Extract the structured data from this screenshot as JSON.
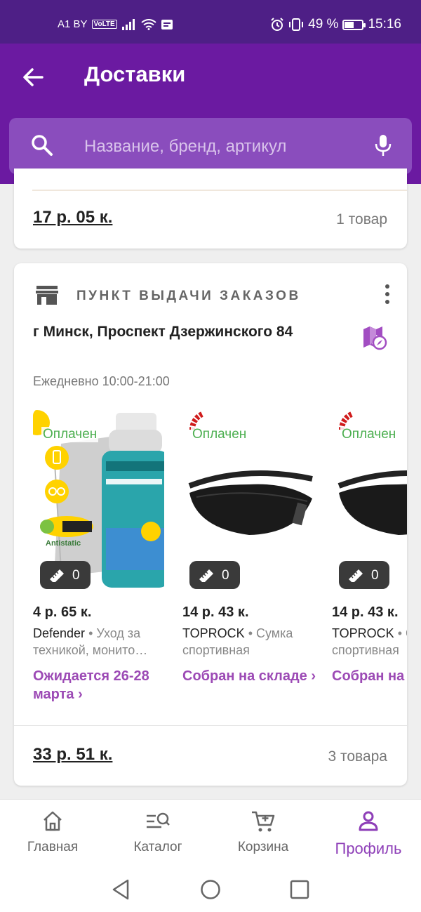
{
  "status_bar": {
    "carrier": "A1 BY",
    "volte": "VoLTE",
    "battery": "49 %",
    "battery_level": 0.49,
    "time": "15:16"
  },
  "app_bar": {
    "title": "Доставки"
  },
  "search": {
    "placeholder": "Название, бренд, артикул"
  },
  "prev_order": {
    "total_price": "17 р. 05 к.",
    "items_count": "1 товар"
  },
  "order": {
    "type_label": "ПУНКТ ВЫДАЧИ ЗАКАЗОВ",
    "address": "г Минск, Проспект Дзержинского 84",
    "hours": "Ежедневно 10:00-21:00",
    "products": [
      {
        "status": "Оплачен",
        "size_count": "0",
        "price": "4 р. 65 к.",
        "brand": "Defender",
        "category": " • Уход за техникой, монито…",
        "delivery": "Ожидается 26-28 марта ›"
      },
      {
        "status": "Оплачен",
        "size_count": "0",
        "price": "14 р. 43 к.",
        "brand": "TOPROCK",
        "category": " • Сумка спортивная",
        "delivery": "Собран на складе ›"
      },
      {
        "status": "Оплачен",
        "size_count": "0",
        "price": "14 р. 43 к.",
        "brand": "TOPROCK",
        "category": " • Сумка спортивная",
        "delivery": "Собран на складе ›"
      }
    ],
    "total_price": "33 р. 51 к.",
    "items_count": "3 товара"
  },
  "bottom_nav": {
    "items": [
      {
        "label": "Главная",
        "icon": "home-icon"
      },
      {
        "label": "Каталог",
        "icon": "catalog-search-icon"
      },
      {
        "label": "Корзина",
        "icon": "cart-icon"
      },
      {
        "label": "Профиль",
        "icon": "profile-icon",
        "active": true
      }
    ]
  },
  "colors": {
    "status_bar": "#4e1f86",
    "app_bar": "#6b1aa1",
    "accent": "#8e3fb8",
    "paid_status": "#4caf50"
  }
}
